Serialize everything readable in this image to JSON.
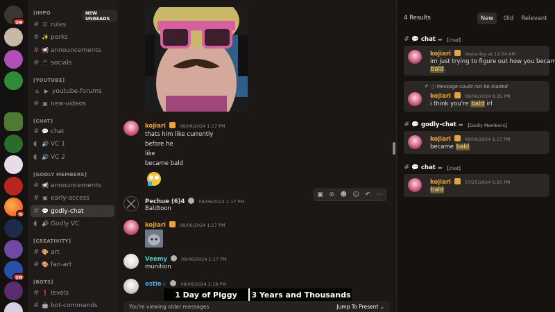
{
  "rail": {
    "home_badge": "29",
    "servers": [
      {
        "color": "#c9b8a6",
        "badge": ""
      },
      {
        "color": "#b04fb8",
        "badge": ""
      },
      {
        "color": "#2e8b3a",
        "badge": ""
      },
      {
        "color": "#4f7a36",
        "badge": ""
      },
      {
        "color": "#2b6b2b",
        "badge": ""
      },
      {
        "color": "#e9dce9",
        "badge": ""
      },
      {
        "color": "#b8261f",
        "badge": ""
      },
      {
        "color": "#f06b1f",
        "badge": "5"
      },
      {
        "color": "#1e2a4a",
        "badge": ""
      },
      {
        "color": "#6f4aa0",
        "badge": ""
      },
      {
        "color": "#2a4fa8",
        "badge": "28"
      },
      {
        "color": "#5a2d6e",
        "badge": ""
      },
      {
        "color": "#d8cfe0",
        "badge": ""
      }
    ]
  },
  "sidebar": {
    "new_unreads": "NEW UNREADS",
    "categories": [
      {
        "label": "[IMPO"
      },
      {
        "label": "[YOUTUBE]"
      },
      {
        "label": "[CHAT]"
      },
      {
        "label": "[GODLY MEMBERS]"
      },
      {
        "label": "[CREATIVITY]"
      },
      {
        "label": "[BOTS]"
      }
    ],
    "channels": [
      {
        "icon": "☑",
        "label": "rules"
      },
      {
        "icon": "✨",
        "label": "perks"
      },
      {
        "icon": "📢",
        "label": "announcements"
      },
      {
        "icon": "📱",
        "label": "socials"
      },
      {
        "icon": "▶",
        "label": "youtube-forums"
      },
      {
        "icon": "▣",
        "label": "new-videos"
      },
      {
        "icon": "💬",
        "label": "chat"
      },
      {
        "icon": "🔊",
        "label": "VC 1"
      },
      {
        "icon": "🔊",
        "label": "VC 2"
      },
      {
        "icon": "📢",
        "label": "announcements"
      },
      {
        "icon": "▣",
        "label": "early-access"
      },
      {
        "icon": "💬",
        "label": "godly-chat"
      },
      {
        "icon": "🔊",
        "label": "Godly VC"
      },
      {
        "icon": "🎨",
        "label": "art"
      },
      {
        "icon": "🎨",
        "label": "fan-art"
      },
      {
        "icon": "❗",
        "label": "levels"
      },
      {
        "icon": "🤖",
        "label": "bot-commands"
      }
    ]
  },
  "main": {
    "messages": [
      {
        "user": "kojiari",
        "color": "#e8a33c",
        "time": "08/06/2024 1:17 PM",
        "lines": [
          "thats him like  currently",
          "before he",
          "like",
          "became bald"
        ]
      },
      {
        "user": "Pechue (6)4",
        "color": "#d7dbe0",
        "time": "08/06/2024 1:17 PM",
        "lines": [
          "Baldtoon"
        ]
      },
      {
        "user": "kojiari",
        "color": "#e8a33c",
        "time": "08/06/2024 1:17 PM",
        "lines": []
      },
      {
        "user": "Veemy",
        "color": "#4fc6c9",
        "time": "08/06/2024 1:17 PM",
        "lines": [
          "munition"
        ]
      },
      {
        "user": "ostie☆",
        "color": "#4fa8e8",
        "time": "08/06/2024 1:18 PM",
        "lines": []
      }
    ],
    "older_notice": "You're viewing older messages",
    "jump_label": "Jump To Present",
    "overlay_left": "1 Day of Piggy",
    "overlay_right": "3 Years and Thousands"
  },
  "results": {
    "count": "4 Results",
    "tabs": [
      "New",
      "Old",
      "Relevant"
    ],
    "groups": [
      {
        "channel": "chat",
        "sub": "【chat】",
        "user": "kojiari",
        "time": "Yesterday at 11:04 AM",
        "pre": "im just trying to figure out how you became",
        "hit": "bald",
        "post": "."
      },
      {
        "channel": "",
        "sub": "",
        "user": "kojiari",
        "time": "08/06/2024 8:35 PM",
        "reply": "Message could not be loaded",
        "pre": "i think you're",
        "hit": "bald",
        "post": "irl"
      },
      {
        "channel": "godly-chat",
        "sub": "【Godly Members】",
        "user": "kojiari",
        "time": "08/06/2024 1:17 PM",
        "pre": "became",
        "hit": "bald",
        "post": ""
      },
      {
        "channel": "chat",
        "sub": "【chat】",
        "user": "kojiari",
        "time": "07/25/2024 5:20 PM",
        "pre": "",
        "hit": "bald",
        "post": ""
      }
    ]
  }
}
